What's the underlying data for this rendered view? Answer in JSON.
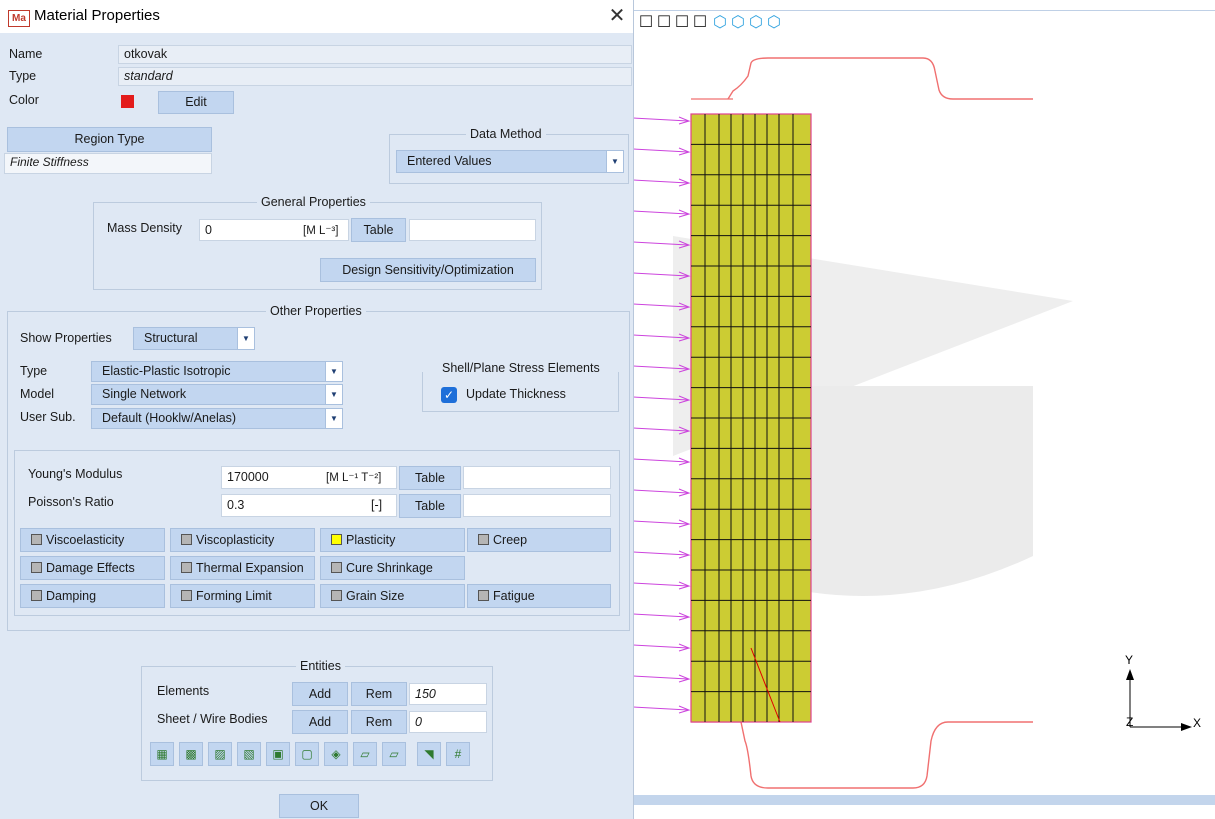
{
  "window": {
    "title": "Material Properties",
    "app_icon": "Ma"
  },
  "fields": {
    "name_label": "Name",
    "name_value": "otkovak",
    "type_label": "Type",
    "type_value": "standard",
    "color_label": "Color",
    "color_value": "#e31b1b",
    "edit_label": "Edit"
  },
  "region": {
    "button_label": "Region Type",
    "value": "Finite Stiffness"
  },
  "data_method": {
    "label": "Data Method",
    "selected": "Entered Values"
  },
  "general": {
    "label": "General Properties",
    "mass_density_label": "Mass Density",
    "mass_density_value": "0",
    "mass_density_unit": "[M L⁻³]",
    "table_label": "Table",
    "design_label": "Design Sensitivity/Optimization"
  },
  "other": {
    "label": "Other Properties",
    "show_label": "Show Properties",
    "show_selected": "Structural",
    "type_label": "Type",
    "type_selected": "Elastic-Plastic Isotropic",
    "model_label": "Model",
    "model_selected": "Single Network",
    "usersub_label": "User Sub.",
    "usersub_selected": "Default (Hooklw/Anelas)",
    "shell_label": "Shell/Plane Stress Elements",
    "update_thickness": "Update Thickness",
    "update_checked": true
  },
  "props": {
    "youngs_label": "Young's Modulus",
    "youngs_value": "170000",
    "youngs_unit": "[M L⁻¹ T⁻²]",
    "poisson_label": "Poisson's Ratio",
    "poisson_value": "0.3",
    "poisson_unit": "[-]",
    "table_label": "Table",
    "options": [
      {
        "label": "Viscoelasticity",
        "active": false
      },
      {
        "label": "Viscoplasticity",
        "active": false
      },
      {
        "label": "Plasticity",
        "active": true
      },
      {
        "label": "Creep",
        "active": false
      },
      {
        "label": "Damage Effects",
        "active": false
      },
      {
        "label": "Thermal Expansion",
        "active": false
      },
      {
        "label": "Cure Shrinkage",
        "active": false
      },
      {
        "label": "Damping",
        "active": false
      },
      {
        "label": "Forming Limit",
        "active": false
      },
      {
        "label": "Grain Size",
        "active": false
      },
      {
        "label": "Fatigue",
        "active": false
      }
    ]
  },
  "entities": {
    "label": "Entities",
    "elements_label": "Elements",
    "elements_count": "150",
    "sheet_label": "Sheet / Wire Bodies",
    "sheet_count": "0",
    "add_label": "Add",
    "rem_label": "Rem",
    "tool_icons": [
      "select-elements-icon",
      "select-faces-icon",
      "select-edges-icon",
      "select-nodes-icon",
      "select-body-icon",
      "select-box-icon",
      "select-region-icon",
      "select-surface-icon",
      "select-plane-icon",
      "select-cursor-icon",
      "select-id-icon"
    ]
  },
  "ok_label": "OK",
  "viewport": {
    "toolbar_icons": [
      "view-iso-1-icon",
      "view-iso-2-icon",
      "view-iso-3-icon",
      "view-iso-4-icon",
      "view-cube-1-icon",
      "view-cube-2-icon",
      "view-cube-3-icon",
      "view-cube-4-icon"
    ],
    "axis_x": "X",
    "axis_y": "Y",
    "axis_z": "Z",
    "mesh_rows": 20,
    "mesh_cols": 9,
    "mesh_fill": "#cccc33"
  }
}
